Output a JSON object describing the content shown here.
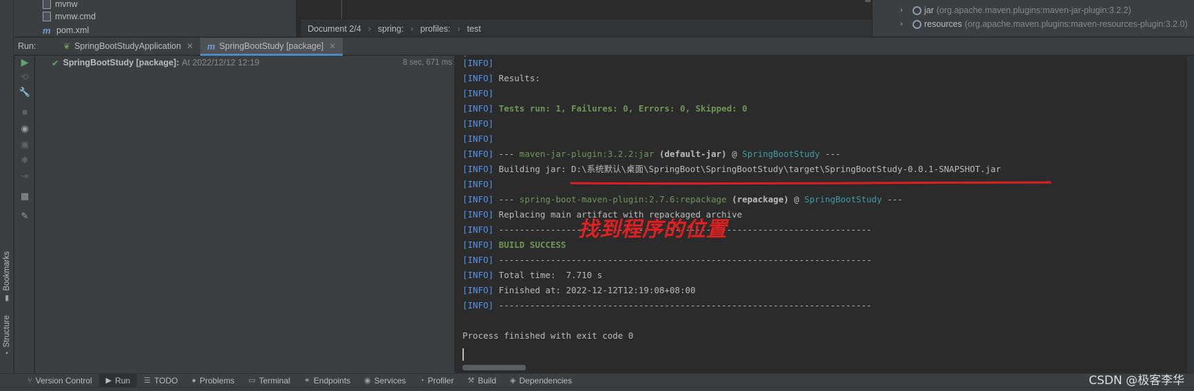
{
  "project_tree": {
    "items": [
      {
        "icon": "file-icon",
        "label": "mvnw"
      },
      {
        "icon": "file-icon",
        "label": "mvnw.cmd"
      },
      {
        "icon": "maven-icon",
        "label": "pom.xml"
      }
    ]
  },
  "breadcrumb": {
    "document": "Document 2/4",
    "parts": [
      "spring:",
      "profiles:",
      "test"
    ]
  },
  "maven_panel": {
    "items": [
      {
        "name": "jar",
        "detail": "(org.apache.maven.plugins:maven-jar-plugin:3.2.2)"
      },
      {
        "name": "resources",
        "detail": "(org.apache.maven.plugins:maven-resources-plugin:3.2.0)"
      }
    ]
  },
  "run_bar": {
    "label": "Run:",
    "tabs": [
      {
        "label": "SpringBootStudyApplication",
        "active": false
      },
      {
        "label": "SpringBootStudy [package]",
        "active": true
      }
    ]
  },
  "left_stripe": {
    "bookmarks": "Bookmarks",
    "structure": "Structure"
  },
  "run_tree": {
    "name": "SpringBootStudy [package]:",
    "time": "At 2022/12/12 12:19",
    "duration": "8 sec, 671 ms"
  },
  "console": {
    "lines": [
      [
        [
          "info",
          "[INFO]"
        ]
      ],
      [
        [
          "info",
          "[INFO]"
        ],
        [
          "bk",
          " Results:"
        ]
      ],
      [
        [
          "info",
          "[INFO]"
        ]
      ],
      [
        [
          "info",
          "[INFO]"
        ],
        [
          "bk",
          " "
        ],
        [
          "green bold",
          "Tests run: 1, Failures: 0, Errors: 0, Skipped: 0"
        ]
      ],
      [
        [
          "info",
          "[INFO]"
        ]
      ],
      [
        [
          "info",
          "[INFO]"
        ]
      ],
      [
        [
          "info",
          "[INFO]"
        ],
        [
          "bk",
          " --- "
        ],
        [
          "green",
          "maven-jar-plugin:3.2.2:jar"
        ],
        [
          "bk bold",
          " (default-jar)"
        ],
        [
          "bk",
          " @ "
        ],
        [
          "teal",
          "SpringBootStudy"
        ],
        [
          "bk",
          " ---"
        ]
      ],
      [
        [
          "info",
          "[INFO]"
        ],
        [
          "bk",
          " Building jar: D:\\系统默认\\桌面\\SpringBoot\\SpringBootStudy\\target\\SpringBootStudy-0.0.1-SNAPSHOT.jar"
        ]
      ],
      [
        [
          "info",
          "[INFO]"
        ]
      ],
      [
        [
          "info",
          "[INFO]"
        ],
        [
          "bk",
          " --- "
        ],
        [
          "green",
          "spring-boot-maven-plugin:2.7.6:repackage"
        ],
        [
          "bk bold",
          " (repackage)"
        ],
        [
          "bk",
          " @ "
        ],
        [
          "teal",
          "SpringBootStudy"
        ],
        [
          "bk",
          " ---"
        ]
      ],
      [
        [
          "info",
          "[INFO]"
        ],
        [
          "bk",
          " Replacing main artifact with repackaged archive"
        ]
      ],
      [
        [
          "info",
          "[INFO]"
        ],
        [
          "bk",
          " ------------------------------------------------------------------------"
        ]
      ],
      [
        [
          "info",
          "[INFO]"
        ],
        [
          "bk",
          " "
        ],
        [
          "green bold",
          "BUILD SUCCESS"
        ]
      ],
      [
        [
          "info",
          "[INFO]"
        ],
        [
          "bk",
          " ------------------------------------------------------------------------"
        ]
      ],
      [
        [
          "info",
          "[INFO]"
        ],
        [
          "bk",
          " Total time:  7.710 s"
        ]
      ],
      [
        [
          "info",
          "[INFO]"
        ],
        [
          "bk",
          " Finished at: 2022-12-12T12:19:08+08:00"
        ]
      ],
      [
        [
          "info",
          "[INFO]"
        ],
        [
          "bk",
          " ------------------------------------------------------------------------"
        ]
      ],
      [],
      [
        [
          "bk",
          "Process finished with exit code 0"
        ]
      ]
    ],
    "annotation": "找到程序的位置",
    "annotation_color": "#e02020"
  },
  "bottom_bar": {
    "items": [
      {
        "icon": "branch-icon",
        "label": "Version Control"
      },
      {
        "icon": "run-icon",
        "label": "Run",
        "active": true
      },
      {
        "icon": "todo-icon",
        "label": "TODO"
      },
      {
        "icon": "problems-icon",
        "label": "Problems"
      },
      {
        "icon": "terminal-icon",
        "label": "Terminal"
      },
      {
        "icon": "endpoints-icon",
        "label": "Endpoints"
      },
      {
        "icon": "services-icon",
        "label": "Services"
      },
      {
        "icon": "profiler-icon",
        "label": "Profiler"
      },
      {
        "icon": "build-icon",
        "label": "Build"
      },
      {
        "icon": "dependencies-icon",
        "label": "Dependencies"
      }
    ],
    "watermark": "CSDN @极客李华"
  }
}
